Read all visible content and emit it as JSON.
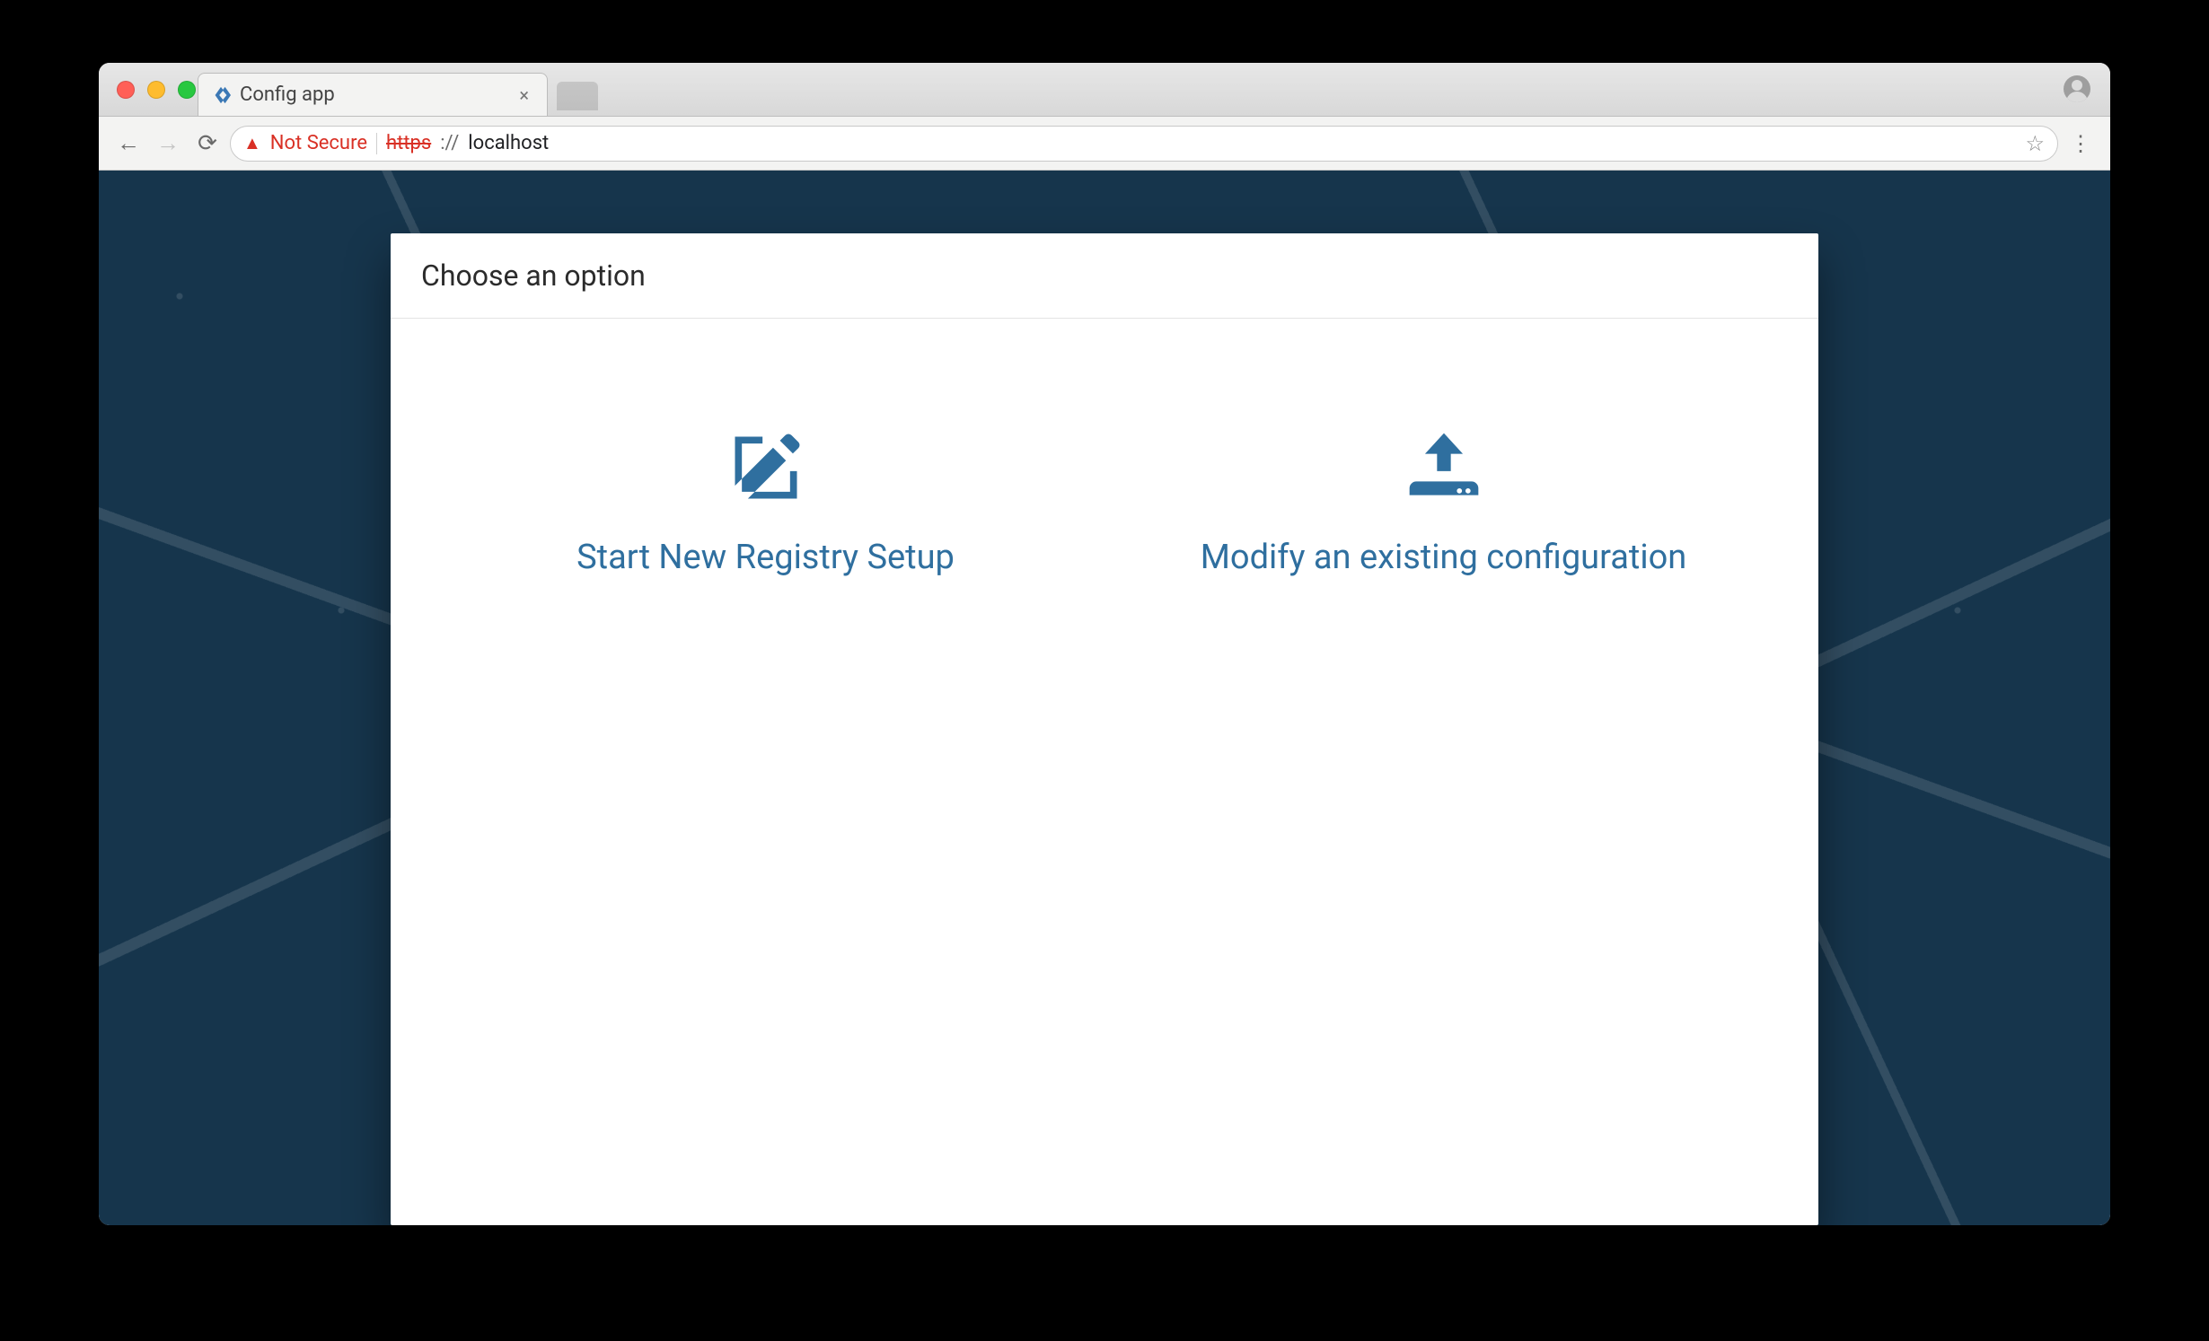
{
  "browser": {
    "tab_title": "Config app",
    "not_secure_label": "Not Secure",
    "url_protocol": "https",
    "url_slashes": "://",
    "url_host": "localhost"
  },
  "card": {
    "heading": "Choose an option",
    "options": [
      {
        "icon": "edit-square-icon",
        "label": "Start New Registry Setup"
      },
      {
        "icon": "upload-icon",
        "label": "Modify an existing configuration"
      }
    ]
  },
  "icons": {
    "close": "×",
    "back": "←",
    "forward": "→",
    "reload": "⟳",
    "warning": "▲",
    "star": "☆",
    "kebab": "⋮"
  }
}
